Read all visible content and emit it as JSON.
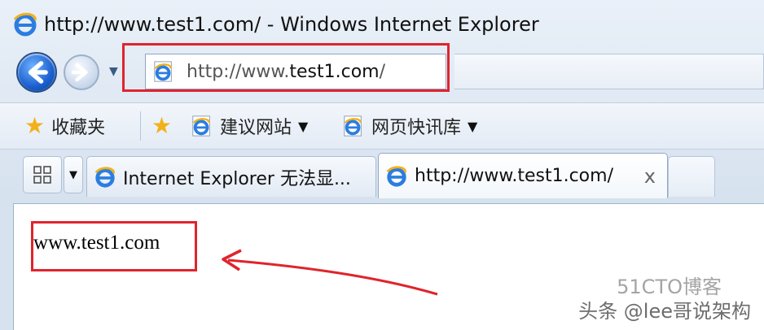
{
  "window": {
    "title": "http://www.test1.com/ - Windows Internet Explorer"
  },
  "nav": {
    "address_prefix": "http://www.",
    "address_host": "test1.com",
    "address_suffix": "/"
  },
  "favorites_bar": {
    "favorites_label": "收藏夹",
    "suggested_sites_label": "建议网站",
    "web_slice_gallery_label": "网页快讯库"
  },
  "tabs": [
    {
      "label": "Internet Explorer 无法显...",
      "active": false
    },
    {
      "label": "http://www.test1.com/",
      "active": true,
      "close": "x"
    }
  ],
  "content": {
    "page_text": "www.test1.com"
  },
  "watermark": {
    "text": "头条 @lee哥说架构",
    "overlay": "51CTO博客"
  },
  "colors": {
    "annotation_red": "#e0242c",
    "chrome_blue": "#dfe8f3"
  },
  "icons": {
    "ie": "ie-logo-icon",
    "back": "back-arrow-icon",
    "forward": "forward-arrow-icon",
    "favorites": "star-icon",
    "add_favorite": "add-favorite-icon",
    "tab_grid": "quick-tabs-icon"
  }
}
